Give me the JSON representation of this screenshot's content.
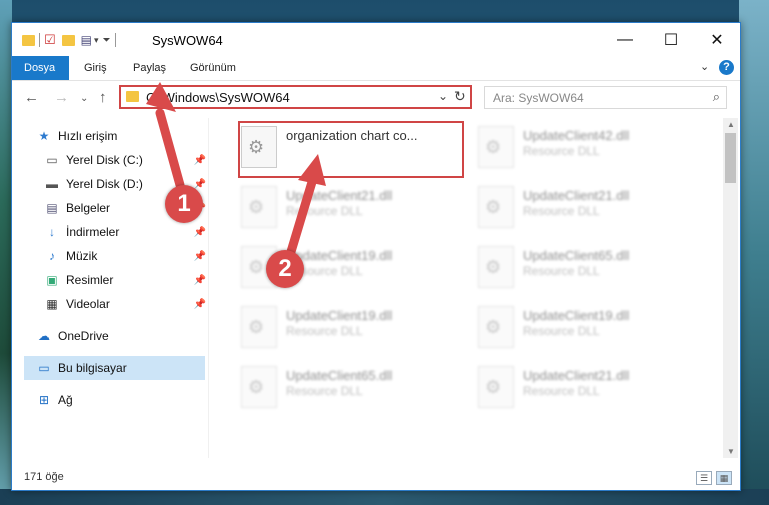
{
  "window": {
    "title": "SysWOW64",
    "controls": {
      "minimize": "—",
      "maximize": "☐",
      "close": "✕"
    }
  },
  "ribbon": {
    "tabs": [
      {
        "label": "Dosya",
        "active": true
      },
      {
        "label": "Giriş"
      },
      {
        "label": "Paylaş"
      },
      {
        "label": "Görünüm"
      }
    ],
    "collapse": "⌄",
    "help": "?"
  },
  "navigation": {
    "address": "C:\\Windows\\SysWOW64",
    "search_placeholder": "Ara: SysWOW64"
  },
  "sidebar": {
    "items": [
      {
        "label": "Hızlı erişim",
        "icon": "star-icon",
        "pinned": false
      },
      {
        "label": "Yerel Disk (C:)",
        "icon": "drive-icon",
        "pinned": true
      },
      {
        "label": "Yerel Disk (D:)",
        "icon": "drive-icon",
        "pinned": true
      },
      {
        "label": "Belgeler",
        "icon": "documents-icon",
        "pinned": true
      },
      {
        "label": "İndirmeler",
        "icon": "download-icon",
        "pinned": true
      },
      {
        "label": "Müzik",
        "icon": "music-icon",
        "pinned": true
      },
      {
        "label": "Resimler",
        "icon": "pictures-icon",
        "pinned": true
      },
      {
        "label": "Videolar",
        "icon": "videos-icon",
        "pinned": true
      },
      {
        "label": "OneDrive",
        "icon": "cloud-icon"
      },
      {
        "label": "Bu bilgisayar",
        "icon": "computer-icon",
        "selected": true
      },
      {
        "label": "Ağ",
        "icon": "network-icon"
      }
    ]
  },
  "files": [
    {
      "name": "organization chart co...",
      "type": ""
    },
    {
      "name": "UpdateClient42.dll",
      "type": "Resource DLL"
    },
    {
      "name": "UpdateClient21.dll",
      "type": "Resource DLL"
    },
    {
      "name": "UpdateClient21.dll",
      "type": "Resource DLL"
    },
    {
      "name": "UpdateClient19.dll",
      "type": "Resource DLL"
    },
    {
      "name": "UpdateClient65.dll",
      "type": "Resource DLL"
    },
    {
      "name": "UpdateClient19.dll",
      "type": "Resource DLL"
    },
    {
      "name": "UpdateClient19.dll",
      "type": "Resource DLL"
    },
    {
      "name": "UpdateClient65.dll",
      "type": "Resource DLL"
    },
    {
      "name": "UpdateClient21.dll",
      "type": "Resource DLL"
    }
  ],
  "status": {
    "count": "171 öğe"
  },
  "annotations": {
    "step1": "1",
    "step2": "2"
  },
  "colors": {
    "accent": "#1979ca",
    "highlight": "#d04545",
    "badge": "#d94a4a"
  }
}
